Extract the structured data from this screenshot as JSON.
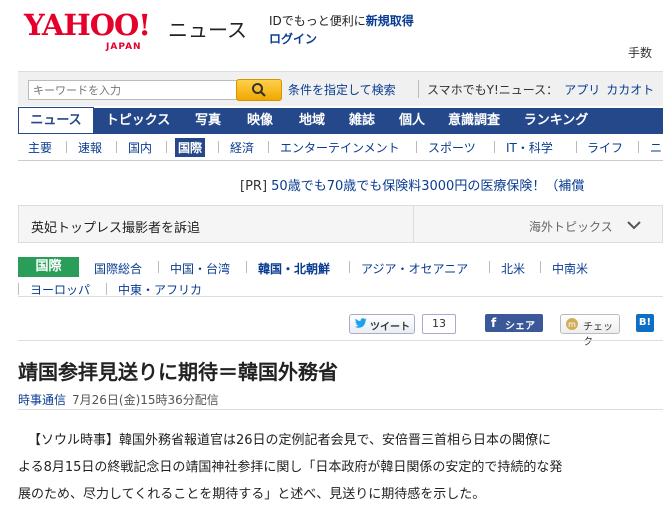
{
  "header": {
    "logo_text": "YAHOO!",
    "logo_sub": "JAPAN",
    "site_title": "ニュース",
    "promo_prefix": "IDでもっと便利に",
    "promo_link": "新規取得",
    "login": "ログイン",
    "top_right": "手数"
  },
  "search": {
    "placeholder": "キーワードを入力",
    "options_link": "条件を指定して検索",
    "sumaho_label": "スマホでもY!ニュース：",
    "sumaho_app": "アプリ",
    "sumaho_calendar": "カカオト"
  },
  "main_nav": [
    "ニュース",
    "トピックス",
    "写真",
    "映像",
    "地域",
    "雑誌",
    "個人",
    "意識調査",
    "ランキング"
  ],
  "sub_nav": [
    "主要",
    "速報",
    "国内",
    "国際",
    "経済",
    "エンターテインメント",
    "スポーツ",
    "IT・科学",
    "ライフ",
    "ニ"
  ],
  "pr": {
    "tag": "[PR]",
    "text": "50歳でも70歳でも保険料3000円の医療保険！（補償"
  },
  "topics": {
    "headline": "英妃トップレス撮影者を訴追",
    "label": "海外トピックス"
  },
  "category": {
    "label": "国際",
    "row1": [
      "国際総合",
      "中国・台湾",
      "韓国・北朝鮮",
      "アジア・オセアニア",
      "北米",
      "中南米"
    ],
    "row2": [
      "ヨーロッパ",
      "中東・アフリカ"
    ]
  },
  "social": {
    "tweet": "ツイート",
    "tweet_count": "13",
    "facebook": "シェア",
    "check": "チェック",
    "hatena": "B!"
  },
  "article": {
    "title": "靖国参拝見送りに期待＝韓国外務省",
    "source": "時事通信",
    "datetime": "7月26日(金)15時36分配信",
    "body_lines": [
      "【ソウル時事】韓国外務省報道官は26日の定例記者会見で、安倍晋三首相ら日本の閣僚に",
      "よる8月15日の終戦記念日の靖国神社参拝に関し「日本政府が韓日関係の安定的で持続的な発",
      "展のため、尽力してくれることを期待する」と述べ、見送りに期待感を示した。"
    ]
  },
  "colors": {
    "brand_red": "#e4002b",
    "nav_blue": "#24488a",
    "link_blue": "#0a3c91",
    "category_green": "#2a9d58"
  }
}
